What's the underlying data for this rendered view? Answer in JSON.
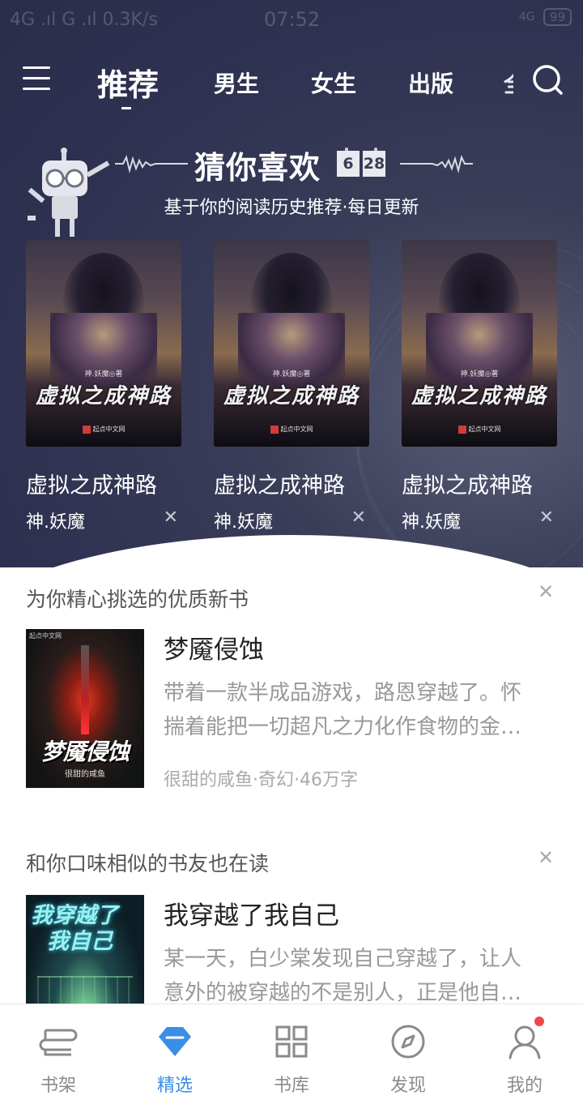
{
  "status_bar": {
    "left": "4G .ıl G .ıl 0.3K/s",
    "time": "07:52",
    "battery": "99",
    "network_right": "4G"
  },
  "nav": {
    "tabs": [
      {
        "label": "推荐"
      },
      {
        "label": "男生"
      },
      {
        "label": "女生"
      },
      {
        "label": "出版"
      },
      {
        "label": "全"
      }
    ],
    "icons": {
      "menu": "menu-icon",
      "search": "search-icon"
    }
  },
  "guess": {
    "title": "猜你喜欢",
    "date_month": "6",
    "date_day": "28",
    "subtitle": "基于你的阅读历史推荐·每日更新",
    "cards": [
      {
        "title": "虚拟之成神路",
        "author": "神.妖魔",
        "cover_title": "虚拟之成神路",
        "cover_author": "神.妖魔◎著",
        "cover_pub": "起点中文网",
        "close": "✕"
      },
      {
        "title": "虚拟之成神路",
        "author": "神.妖魔",
        "cover_title": "虚拟之成神路",
        "cover_author": "神.妖魔◎著",
        "cover_pub": "起点中文网",
        "close": "✕"
      },
      {
        "title": "虚拟之成神路",
        "author": "神.妖魔",
        "cover_title": "虚拟之成神路",
        "cover_author": "神.妖魔◎著",
        "cover_pub": "起点中文网",
        "close": "✕"
      }
    ]
  },
  "sections": [
    {
      "heading": "为你精心挑选的优质新书",
      "close": "✕",
      "book": {
        "title": "梦魇侵蚀",
        "desc_line1": "带着一款半成品游戏，路恩穿越了。怀",
        "desc_line2": "揣着能把一切超凡之力化作食物的金…",
        "meta": "很甜的咸鱼·奇幻·46万字",
        "cover_title": "梦魇侵蚀",
        "cover_author": "很甜的咸鱼",
        "cover_pub": "起点中文网"
      }
    },
    {
      "heading": "和你口味相似的书友也在读",
      "close": "✕",
      "book": {
        "title": "我穿越了我自己",
        "desc_line1": "某一天，白少棠发现自己穿越了，让人",
        "desc_line2": "意外的被穿越的不是别人，正是他自…",
        "cover_title_1": "我穿越了",
        "cover_title_2": "我自己"
      }
    }
  ],
  "tabbar": {
    "tabs": [
      {
        "label": "书架",
        "icon": "bookshelf-icon"
      },
      {
        "label": "精选",
        "icon": "diamond-icon"
      },
      {
        "label": "书库",
        "icon": "grid-icon"
      },
      {
        "label": "发现",
        "icon": "compass-icon"
      },
      {
        "label": "我的",
        "icon": "user-icon"
      }
    ],
    "active_index": 1,
    "active_color": "#3a8ee6",
    "inactive_color": "#8a8a8a",
    "badge_color": "#f04848"
  }
}
